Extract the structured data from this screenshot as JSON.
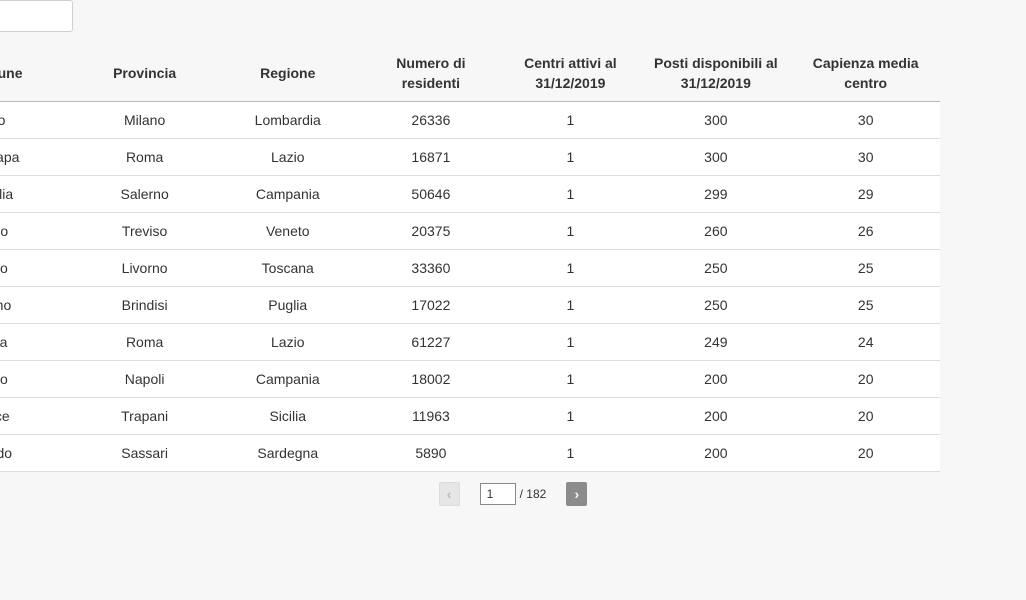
{
  "search": {
    "value": ""
  },
  "table": {
    "headers": [
      "Comune",
      "Provincia",
      "Regione",
      "Numero di residenti",
      "Centri attivi al 31/12/2019",
      "Posti disponibili al 31/12/2019",
      "Capienza media centro"
    ],
    "rows": [
      [
        "sso",
        "Milano",
        "Lombardia",
        "26336",
        "1",
        "300",
        "30"
      ],
      [
        "Di Papa",
        "Roma",
        "Lazio",
        "16871",
        "1",
        "300",
        "30"
      ],
      [
        "baglia",
        "Salerno",
        "Campania",
        "50646",
        "1",
        "299",
        "29"
      ],
      [
        "erzo",
        "Treviso",
        "Veneto",
        "20375",
        "1",
        "260",
        "26"
      ],
      [
        "bino",
        "Livorno",
        "Toscana",
        "33360",
        "1",
        "250",
        "25"
      ],
      [
        "vigno",
        "Brindisi",
        "Puglia",
        "17022",
        "1",
        "250",
        "25"
      ],
      [
        "ezia",
        "Roma",
        "Lazio",
        "61227",
        "1",
        "249",
        "24"
      ],
      [
        "igno",
        "Napoli",
        "Campania",
        "18002",
        "1",
        "200",
        "20"
      ],
      [
        "erice",
        "Trapani",
        "Sicilia",
        "11963",
        "1",
        "200",
        "20"
      ],
      [
        "sardo",
        "Sassari",
        "Sardegna",
        "5890",
        "1",
        "200",
        "20"
      ]
    ]
  },
  "pagination": {
    "prev_label": "‹",
    "next_label": "›",
    "current_page": "1",
    "total_label": "/ 182"
  }
}
